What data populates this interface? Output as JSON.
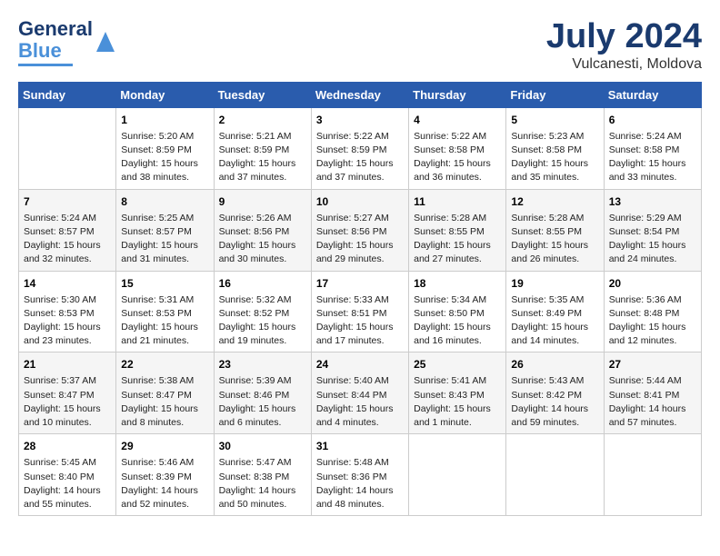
{
  "header": {
    "logo_line1": "General",
    "logo_line2": "Blue",
    "month_year": "July 2024",
    "location": "Vulcanesti, Moldova"
  },
  "weekdays": [
    "Sunday",
    "Monday",
    "Tuesday",
    "Wednesday",
    "Thursday",
    "Friday",
    "Saturday"
  ],
  "weeks": [
    [
      {
        "day": "",
        "content": ""
      },
      {
        "day": "1",
        "content": "Sunrise: 5:20 AM\nSunset: 8:59 PM\nDaylight: 15 hours\nand 38 minutes."
      },
      {
        "day": "2",
        "content": "Sunrise: 5:21 AM\nSunset: 8:59 PM\nDaylight: 15 hours\nand 37 minutes."
      },
      {
        "day": "3",
        "content": "Sunrise: 5:22 AM\nSunset: 8:59 PM\nDaylight: 15 hours\nand 37 minutes."
      },
      {
        "day": "4",
        "content": "Sunrise: 5:22 AM\nSunset: 8:58 PM\nDaylight: 15 hours\nand 36 minutes."
      },
      {
        "day": "5",
        "content": "Sunrise: 5:23 AM\nSunset: 8:58 PM\nDaylight: 15 hours\nand 35 minutes."
      },
      {
        "day": "6",
        "content": "Sunrise: 5:24 AM\nSunset: 8:58 PM\nDaylight: 15 hours\nand 33 minutes."
      }
    ],
    [
      {
        "day": "7",
        "content": "Sunrise: 5:24 AM\nSunset: 8:57 PM\nDaylight: 15 hours\nand 32 minutes."
      },
      {
        "day": "8",
        "content": "Sunrise: 5:25 AM\nSunset: 8:57 PM\nDaylight: 15 hours\nand 31 minutes."
      },
      {
        "day": "9",
        "content": "Sunrise: 5:26 AM\nSunset: 8:56 PM\nDaylight: 15 hours\nand 30 minutes."
      },
      {
        "day": "10",
        "content": "Sunrise: 5:27 AM\nSunset: 8:56 PM\nDaylight: 15 hours\nand 29 minutes."
      },
      {
        "day": "11",
        "content": "Sunrise: 5:28 AM\nSunset: 8:55 PM\nDaylight: 15 hours\nand 27 minutes."
      },
      {
        "day": "12",
        "content": "Sunrise: 5:28 AM\nSunset: 8:55 PM\nDaylight: 15 hours\nand 26 minutes."
      },
      {
        "day": "13",
        "content": "Sunrise: 5:29 AM\nSunset: 8:54 PM\nDaylight: 15 hours\nand 24 minutes."
      }
    ],
    [
      {
        "day": "14",
        "content": "Sunrise: 5:30 AM\nSunset: 8:53 PM\nDaylight: 15 hours\nand 23 minutes."
      },
      {
        "day": "15",
        "content": "Sunrise: 5:31 AM\nSunset: 8:53 PM\nDaylight: 15 hours\nand 21 minutes."
      },
      {
        "day": "16",
        "content": "Sunrise: 5:32 AM\nSunset: 8:52 PM\nDaylight: 15 hours\nand 19 minutes."
      },
      {
        "day": "17",
        "content": "Sunrise: 5:33 AM\nSunset: 8:51 PM\nDaylight: 15 hours\nand 17 minutes."
      },
      {
        "day": "18",
        "content": "Sunrise: 5:34 AM\nSunset: 8:50 PM\nDaylight: 15 hours\nand 16 minutes."
      },
      {
        "day": "19",
        "content": "Sunrise: 5:35 AM\nSunset: 8:49 PM\nDaylight: 15 hours\nand 14 minutes."
      },
      {
        "day": "20",
        "content": "Sunrise: 5:36 AM\nSunset: 8:48 PM\nDaylight: 15 hours\nand 12 minutes."
      }
    ],
    [
      {
        "day": "21",
        "content": "Sunrise: 5:37 AM\nSunset: 8:47 PM\nDaylight: 15 hours\nand 10 minutes."
      },
      {
        "day": "22",
        "content": "Sunrise: 5:38 AM\nSunset: 8:47 PM\nDaylight: 15 hours\nand 8 minutes."
      },
      {
        "day": "23",
        "content": "Sunrise: 5:39 AM\nSunset: 8:46 PM\nDaylight: 15 hours\nand 6 minutes."
      },
      {
        "day": "24",
        "content": "Sunrise: 5:40 AM\nSunset: 8:44 PM\nDaylight: 15 hours\nand 4 minutes."
      },
      {
        "day": "25",
        "content": "Sunrise: 5:41 AM\nSunset: 8:43 PM\nDaylight: 15 hours\nand 1 minute."
      },
      {
        "day": "26",
        "content": "Sunrise: 5:43 AM\nSunset: 8:42 PM\nDaylight: 14 hours\nand 59 minutes."
      },
      {
        "day": "27",
        "content": "Sunrise: 5:44 AM\nSunset: 8:41 PM\nDaylight: 14 hours\nand 57 minutes."
      }
    ],
    [
      {
        "day": "28",
        "content": "Sunrise: 5:45 AM\nSunset: 8:40 PM\nDaylight: 14 hours\nand 55 minutes."
      },
      {
        "day": "29",
        "content": "Sunrise: 5:46 AM\nSunset: 8:39 PM\nDaylight: 14 hours\nand 52 minutes."
      },
      {
        "day": "30",
        "content": "Sunrise: 5:47 AM\nSunset: 8:38 PM\nDaylight: 14 hours\nand 50 minutes."
      },
      {
        "day": "31",
        "content": "Sunrise: 5:48 AM\nSunset: 8:36 PM\nDaylight: 14 hours\nand 48 minutes."
      },
      {
        "day": "",
        "content": ""
      },
      {
        "day": "",
        "content": ""
      },
      {
        "day": "",
        "content": ""
      }
    ]
  ]
}
